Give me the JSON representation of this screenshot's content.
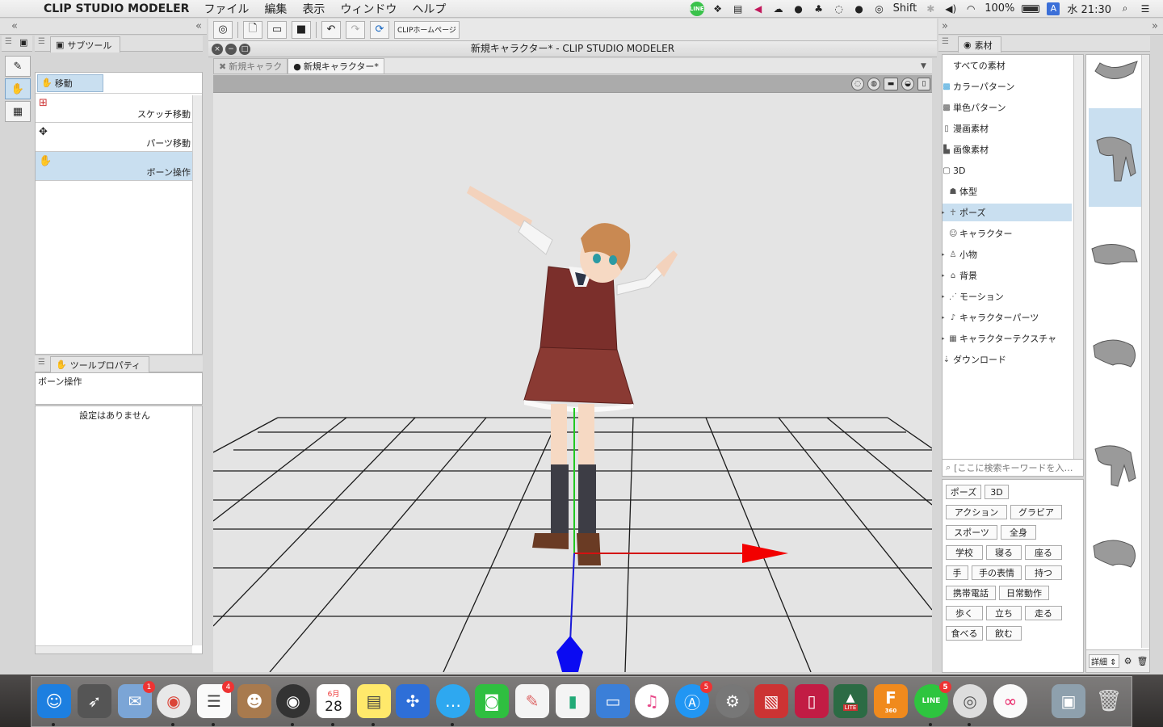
{
  "menubar": {
    "app_name": "CLIP STUDIO MODELER",
    "menus": [
      "ファイル",
      "編集",
      "表示",
      "ウィンドウ",
      "ヘルプ"
    ],
    "status": {
      "line_icon": "LINE",
      "shift": "Shift",
      "battery": "100%",
      "ime": "A",
      "clock": "水 21:30"
    }
  },
  "left": {
    "subtool_panel": {
      "tab_label": "サブツール",
      "group_button": "移動",
      "items": [
        {
          "label": "スケッチ移動",
          "active": false
        },
        {
          "label": "パーツ移動",
          "active": false
        },
        {
          "label": "ボーン操作",
          "active": true
        }
      ]
    },
    "toolprop_panel": {
      "tab_label": "ツールプロパティ",
      "tool_name": "ボーン操作",
      "message": "設定はありません"
    }
  },
  "center": {
    "home_button": "CLIPホームページ",
    "window_title": "新規キャラクター* - CLIP STUDIO MODELER",
    "tabs": [
      {
        "label": "新規キャラク",
        "active": false
      },
      {
        "label": "新規キャラクター*",
        "active": true
      }
    ]
  },
  "right": {
    "panel_tab": "素材",
    "tree": [
      {
        "label": "すべての素材",
        "icon": "none",
        "selected": false
      },
      {
        "label": "カラーパターン",
        "icon": "color-pattern-icon",
        "selected": false
      },
      {
        "label": "単色パターン",
        "icon": "mono-pattern-icon",
        "selected": false
      },
      {
        "label": "漫画素材",
        "icon": "manga-icon",
        "selected": false
      },
      {
        "label": "画像素材",
        "icon": "image-icon",
        "selected": false
      },
      {
        "label": "3D",
        "icon": "3d-icon",
        "selected": false
      },
      {
        "label": "体型",
        "icon": "body-icon",
        "selected": false
      },
      {
        "label": "ポーズ",
        "icon": "pose-icon",
        "selected": true
      },
      {
        "label": "キャラクター",
        "icon": "character-icon",
        "selected": false
      },
      {
        "label": "小物",
        "icon": "prop-icon",
        "selected": false
      },
      {
        "label": "背景",
        "icon": "background-icon",
        "selected": false
      },
      {
        "label": "モーション",
        "icon": "motion-icon",
        "selected": false
      },
      {
        "label": "キャラクターパーツ",
        "icon": "parts-icon",
        "selected": false
      },
      {
        "label": "キャラクターテクスチャ",
        "icon": "texture-icon",
        "selected": false
      },
      {
        "label": "ダウンロード",
        "icon": "download-icon",
        "selected": false
      }
    ],
    "search_placeholder": "[ここに検索キーワードを入…",
    "tags": [
      "ポーズ",
      "3D",
      "アクション",
      "グラビア",
      "スポーツ",
      "全身",
      "学校",
      "寝る",
      "座る",
      "手",
      "手の表情",
      "持つ",
      "携帯電話",
      "日常動作",
      "歩く",
      "立ち",
      "走る",
      "食べる",
      "飲む"
    ],
    "detail_button": "詳細"
  },
  "dock": {
    "badges": {
      "mail": "1",
      "reminders": "4",
      "appstore": "5",
      "line": "5"
    },
    "calendar_month": "6月",
    "calendar_day": "28",
    "fusion_label": "360",
    "line_label": "LINE",
    "lite_label": "LITE"
  }
}
